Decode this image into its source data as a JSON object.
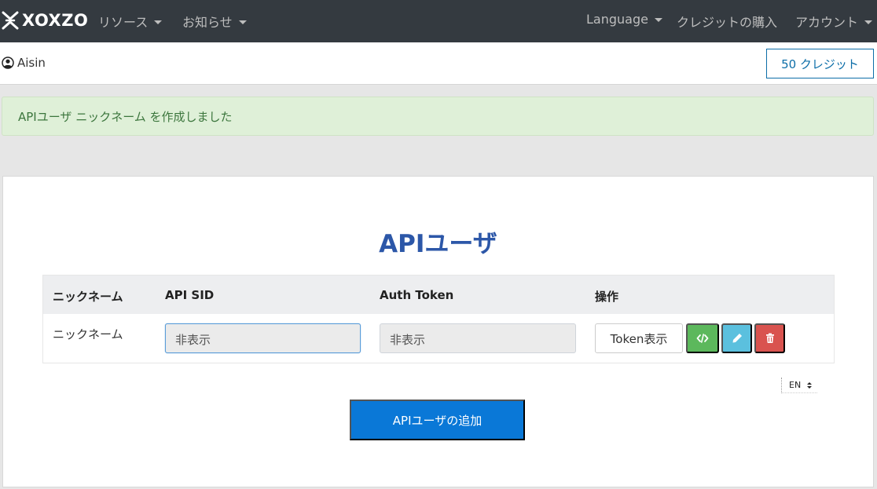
{
  "navbar": {
    "brand": "XOXZO",
    "menu_left": [
      {
        "label": "リソース"
      },
      {
        "label": "お知らせ"
      }
    ],
    "language": "Language",
    "buy_credits": "クレジットの購入",
    "account": "アカウント"
  },
  "userbar": {
    "username": "Aisin",
    "credits": "50 クレジット"
  },
  "alert": {
    "message": "APIユーザ ニックネーム を作成しました",
    "color": "#dff0d8"
  },
  "panel": {
    "title": "APIユーザ",
    "table": {
      "headers": [
        "ニックネーム",
        "API SID",
        "Auth Token",
        "操作"
      ],
      "rows": [
        {
          "nickname": "ニックネーム",
          "api_sid": "非表示",
          "auth_token": "非表示",
          "token_button": "Token表示"
        }
      ]
    },
    "language_select": "EN",
    "add_button": "APIユーザの追加"
  },
  "icons": {
    "code": "code-icon",
    "edit": "pencil-icon",
    "delete": "trash-icon"
  },
  "colors": {
    "code_button": "#5cb85c",
    "edit_button": "#5bc0de",
    "delete_button": "#d9534f",
    "primary": "#0a78d7",
    "title": "#2c57a8"
  }
}
